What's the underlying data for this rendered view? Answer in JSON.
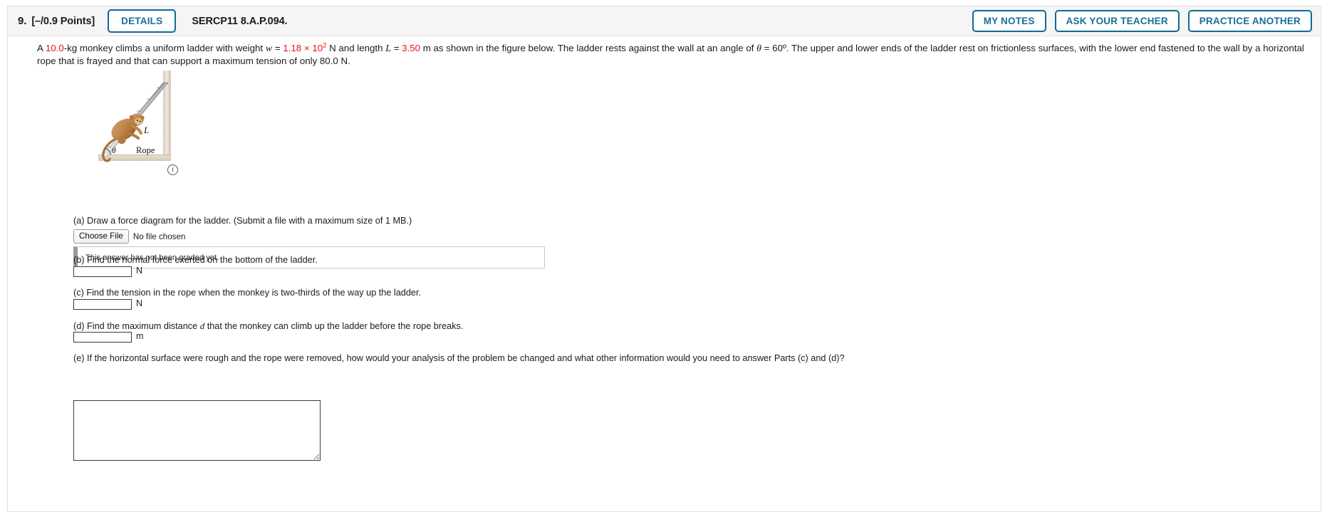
{
  "header": {
    "question_number": "9.",
    "points": "[–/0.9 Points]",
    "details_label": "DETAILS",
    "question_code": "SERCP11 8.A.P.094.",
    "actions": [
      {
        "label": "MY NOTES",
        "name": "my-notes-button"
      },
      {
        "label": "ASK YOUR TEACHER",
        "name": "ask-your-teacher-button"
      },
      {
        "label": "PRACTICE ANOTHER",
        "name": "practice-another-button"
      }
    ],
    "accent_color": "#0f6a94",
    "bar_bg": "#f5f5f5"
  },
  "problem": {
    "seg1": "A ",
    "mass": "10.0",
    "seg2": "-kg monkey climbs a uniform ladder with weight ",
    "w_symbol": "w",
    "eq1": " = ",
    "weight_mantissa": "1.18 ",
    "weight_times": "× 10",
    "weight_exponent": "2",
    "seg3": " N and length ",
    "L_symbol": "L",
    "eq2": " = ",
    "length_value": "3.50",
    "seg4": " m as shown in the figure below. The ladder rests against the wall at an angle of ",
    "theta_symbol": "θ",
    "eq3": " = ",
    "angle_value": "60º",
    "seg5": ". The upper and lower ends of the ladder rest on frictionless surfaces, with the lower end fastened to the wall by a horizontal rope that is frayed and that can support a maximum tension of only 80.0 N.",
    "value_color": "#e8131a"
  },
  "figure": {
    "ladder_label": "L",
    "angle_label": "θ",
    "rope_label": "Rope",
    "info_icon_glyph": "i",
    "wall_color": "#e6ddd1",
    "floor_color": "#e6ddd1",
    "ladder_color": "#c9cbcd",
    "monkey_color": "#c08a4e"
  },
  "parts": [
    {
      "id": "a",
      "label": "(a) Draw a force diagram for the ladder. (Submit a file with a maximum size of 1 MB.)",
      "choose_file_label": "Choose File",
      "no_file_text": "No file chosen",
      "graded_notice": "This answer has not been graded yet."
    },
    {
      "id": "b",
      "label": "(b) Find the normal force exerted on the bottom of the ladder.",
      "value": "",
      "unit": "N"
    },
    {
      "id": "c",
      "label": "(c) Find the tension in the rope when the monkey is two-thirds of the way up the ladder.",
      "value": "",
      "unit": "N"
    },
    {
      "id": "d",
      "label_pre": "(d) Find the maximum distance ",
      "label_var": "d",
      "label_post": " that the monkey can climb up the ladder before the rope breaks.",
      "value": "",
      "unit": "m"
    },
    {
      "id": "e",
      "label": "(e) If the horizontal surface were rough and the rope were removed, how would your analysis of the problem be changed and what other information would you need to answer Parts (c) and (d)?",
      "value": ""
    }
  ]
}
